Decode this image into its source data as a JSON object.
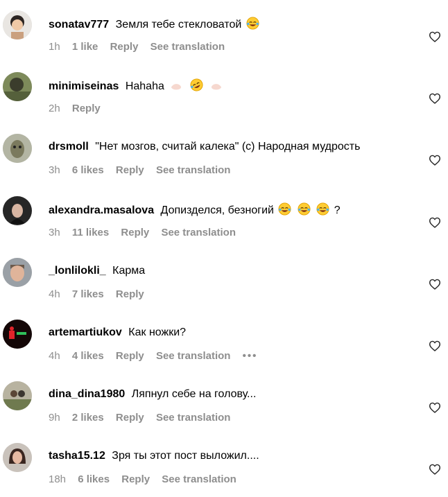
{
  "colors": {
    "primary_text": "#000000",
    "secondary_text": "#8e8e8e"
  },
  "comments": [
    {
      "username": "sonatav777",
      "text": "Земля тебе стекловатой",
      "time": "1h",
      "likes": "1 like",
      "reply": "Reply",
      "translate": "See translation"
    },
    {
      "username": "minimiseinas",
      "text": "Hahaha",
      "time": "2h",
      "likes": "",
      "reply": "Reply",
      "translate": ""
    },
    {
      "username": "drsmoll",
      "text": "\"Нет мозгов, считай калека\" (с) Народная мудрость",
      "time": "3h",
      "likes": "6 likes",
      "reply": "Reply",
      "translate": "See translation"
    },
    {
      "username": "alexandra.masalova",
      "text": "Допизделся, безногий",
      "text_after": "?",
      "time": "3h",
      "likes": "11 likes",
      "reply": "Reply",
      "translate": "See translation"
    },
    {
      "username": "_lonlilokli_",
      "text": "Карма",
      "time": "4h",
      "likes": "7 likes",
      "reply": "Reply",
      "translate": ""
    },
    {
      "username": "artemartiukov",
      "text": "Как ножки?",
      "time": "4h",
      "likes": "4 likes",
      "reply": "Reply",
      "translate": "See translation",
      "more": "•••"
    },
    {
      "username": "dina_dina1980",
      "text": "Ляпнул себе на голову...",
      "time": "9h",
      "likes": "2 likes",
      "reply": "Reply",
      "translate": "See translation"
    },
    {
      "username": "tasha15.12",
      "text": "Зря ты этот пост выложил....",
      "time": "18h",
      "likes": "6 likes",
      "reply": "Reply",
      "translate": "See translation"
    }
  ],
  "icons": {
    "like": "heart-outline-icon",
    "laugh": "face-with-tears-of-joy-icon",
    "rofl": "rolling-on-floor-laughing-icon",
    "hand": "waving-hand-icon",
    "more": "more-options-icon"
  }
}
